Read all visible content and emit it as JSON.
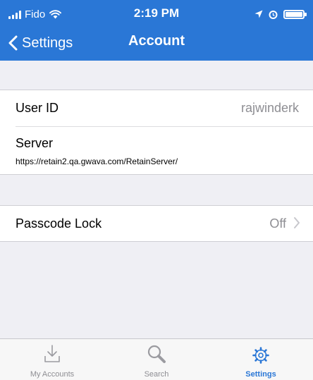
{
  "status_bar": {
    "carrier": "Fido",
    "time": "2:19 PM",
    "icons": [
      "signal-icon",
      "wifi-icon",
      "location-icon",
      "alarm-icon",
      "battery-icon"
    ]
  },
  "nav": {
    "back_label": "Settings",
    "title": "Account"
  },
  "account": {
    "user_id_label": "User ID",
    "user_id_value": "rajwinderk",
    "server_label": "Server",
    "server_url": "https://retain2.qa.gwava.com/RetainServer/"
  },
  "security": {
    "passcode_label": "Passcode Lock",
    "passcode_value": "Off"
  },
  "tabs": [
    {
      "label": "My Accounts",
      "icon": "download-tray-icon"
    },
    {
      "label": "Search",
      "icon": "magnifier-icon"
    },
    {
      "label": "Settings",
      "icon": "gear-icon",
      "selected": true
    }
  ],
  "colors": {
    "accent": "#2a77d6",
    "background": "#efeff4",
    "secondary_text": "#8e8e93"
  }
}
